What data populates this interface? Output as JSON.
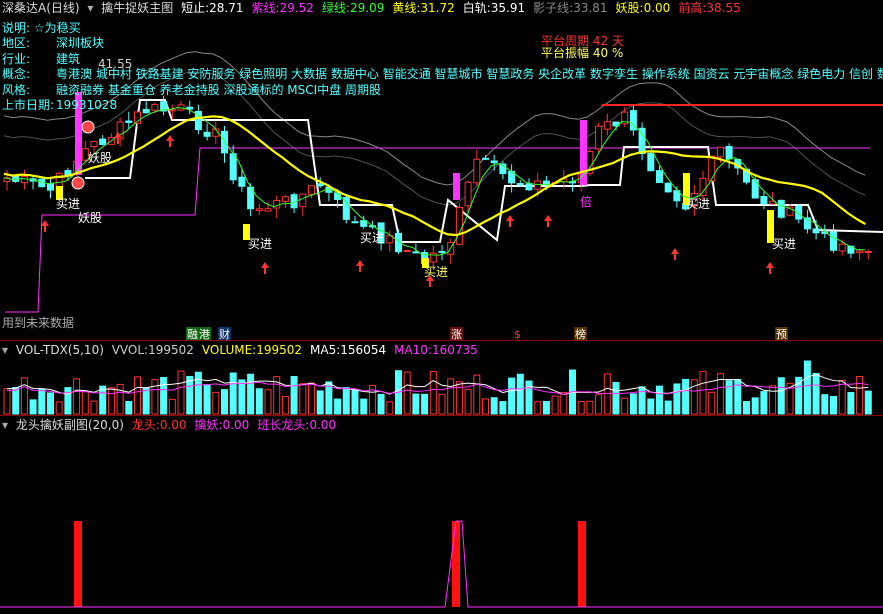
{
  "main_header": {
    "stock": "深桑达A(日线)",
    "indicator": "擒牛捉妖主图",
    "fields": [
      {
        "label": "短止:",
        "value": "28.71",
        "color": "#ffffff"
      },
      {
        "label": "紫线:",
        "value": "29.52",
        "color": "#ff33ff"
      },
      {
        "label": "绿线:",
        "value": "29.09",
        "color": "#33ff33"
      },
      {
        "label": "黄线:",
        "value": "31.72",
        "color": "#ffff00"
      },
      {
        "label": "白轨:",
        "value": "35.91",
        "color": "#ffffff"
      },
      {
        "label": "影子线:",
        "value": "33.81",
        "color": "#888888"
      },
      {
        "label": "妖股:",
        "value": "0.00",
        "color": "#ffff00"
      },
      {
        "label": "前高:",
        "value": "38.55",
        "color": "#ff3333"
      }
    ]
  },
  "info_panel": {
    "note": "说明: ☆为稳买",
    "region_label": "地区:",
    "region_value": "深圳板块",
    "industry_label": "行业:",
    "industry_value": "建筑",
    "concept_label": "概念:",
    "concept_value": "粤港澳 城中村 铁路基建 安防服务 绿色照明 大数据 数据中心 智能交通 智慧城市 智慧政务 央企改革 数字孪生 操作系统 国资云 元宇宙概念 绿色电力 信创 数据",
    "style_label": "风格:",
    "style_value": "融资融券 基金重仓 养老金持股 深股通标的 MSCI中盘 周期股",
    "listing_label": "上市日期:",
    "listing_value": "19931028"
  },
  "platform": {
    "period_label": "平台周期",
    "period_value": "42 天",
    "amplitude_label": "平台振幅",
    "amplitude_value": "40 %"
  },
  "chart_annotations": {
    "peak_price": "41.55",
    "future_data_note": "用到未来数据",
    "tags": [
      {
        "text": "妖股",
        "color": "#ffffff"
      },
      {
        "text": "妖股",
        "color": "#ffffff"
      },
      {
        "text": "买进",
        "color": "#ffffff"
      },
      {
        "text": "买进",
        "color": "#ffffff"
      },
      {
        "text": "买进",
        "color": "#ffffff"
      },
      {
        "text": "买进",
        "color": "#ffff66"
      },
      {
        "text": "倍",
        "color": "#ff33ff"
      },
      {
        "text": "买进",
        "color": "#ffffff"
      },
      {
        "text": "买进",
        "color": "#ffffff"
      }
    ],
    "event_markers": [
      {
        "text": "融",
        "bg": "#116611",
        "color": "#ffffff"
      },
      {
        "text": "港",
        "bg": "#116611",
        "color": "#ffffff"
      },
      {
        "text": "财",
        "bg": "#113366",
        "color": "#ffffff"
      },
      {
        "text": "涨",
        "bg": "#661111",
        "color": "#ffffff"
      },
      {
        "text": "$",
        "bg": "#000000",
        "color": "#ff3333"
      },
      {
        "text": "榜",
        "bg": "#553300",
        "color": "#ffffff"
      },
      {
        "text": "预",
        "bg": "#553300",
        "color": "#ffffff"
      }
    ]
  },
  "vol_header": {
    "indicator": "VOL-TDX(5,10)",
    "fields": [
      {
        "label": "VVOL:",
        "value": "199502",
        "color": "#cccccc"
      },
      {
        "label": "VOLUME:",
        "value": "199502",
        "color": "#ffff00"
      },
      {
        "label": "MA5:",
        "value": "156054",
        "color": "#ffffff"
      },
      {
        "label": "MA10:",
        "value": "160735",
        "color": "#ff33ff"
      }
    ]
  },
  "sub_header": {
    "indicator": "龙头擒妖副图(20,0)",
    "fields": [
      {
        "label": "龙头:",
        "value": "0.00",
        "color": "#ff3333"
      },
      {
        "label": "擒妖:",
        "value": "0.00",
        "color": "#ff33ff"
      },
      {
        "label": "班长龙头:",
        "value": "0.00",
        "color": "#ff33ff"
      }
    ]
  },
  "colors": {
    "up": "#ff3333",
    "down": "#54ffff",
    "yellow": "#ffff00",
    "white": "#ffffff",
    "magenta": "#ff33ff",
    "green": "#33ff33",
    "shadow": "#888888",
    "separator": "#8b0000"
  }
}
